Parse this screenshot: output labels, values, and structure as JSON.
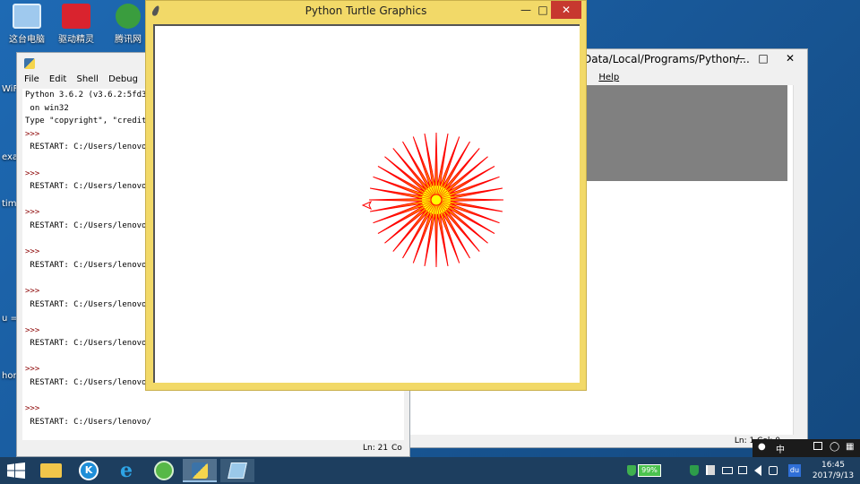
{
  "desktop": {
    "icons": [
      {
        "label": "这台电脑",
        "icon": "computer-icon",
        "color": "#9fc9ee"
      },
      {
        "label": "驱动精灵",
        "icon": "driver-genius-icon",
        "color": "#d9232e"
      },
      {
        "label": "腾讯网",
        "icon": "tencent-icon",
        "color": "#3a9d3e"
      }
    ],
    "peek_labels": [
      "WiF",
      "exa",
      "tim",
      "u =",
      "hor"
    ]
  },
  "shell_window": {
    "menu": [
      "File",
      "Edit",
      "Shell",
      "Debug",
      "Op"
    ],
    "console_lines": [
      {
        "kind": "out",
        "text": "Python 3.6.2 (v3.6.2:5fd3"
      },
      {
        "kind": "out",
        "text": " on win32"
      },
      {
        "kind": "out",
        "text": "Type \"copyright\", \"credit"
      },
      {
        "kind": "prompt",
        "text": ">>>"
      },
      {
        "kind": "out",
        "text": " RESTART: C:/Users/lenovo/"
      },
      {
        "kind": "out",
        "text": ""
      },
      {
        "kind": "prompt",
        "text": ">>>"
      },
      {
        "kind": "out",
        "text": " RESTART: C:/Users/lenovo/"
      },
      {
        "kind": "out",
        "text": ""
      },
      {
        "kind": "prompt",
        "text": ">>>"
      },
      {
        "kind": "out",
        "text": " RESTART: C:/Users/lenovo/"
      },
      {
        "kind": "out",
        "text": ""
      },
      {
        "kind": "prompt",
        "text": ">>>"
      },
      {
        "kind": "out",
        "text": " RESTART: C:/Users/lenovo/"
      },
      {
        "kind": "out",
        "text": ""
      },
      {
        "kind": "prompt",
        "text": ">>>"
      },
      {
        "kind": "out",
        "text": " RESTART: C:/Users/lenovo/"
      },
      {
        "kind": "out",
        "text": ""
      },
      {
        "kind": "prompt",
        "text": ">>>"
      },
      {
        "kind": "out",
        "text": " RESTART: C:/Users/lenovo/"
      },
      {
        "kind": "out",
        "text": ""
      },
      {
        "kind": "prompt",
        "text": ">>>"
      },
      {
        "kind": "out",
        "text": " RESTART: C:/Users/lenovo/"
      },
      {
        "kind": "out",
        "text": ""
      },
      {
        "kind": "prompt",
        "text": ">>>"
      },
      {
        "kind": "out",
        "text": " RESTART: C:/Users/lenovo/"
      },
      {
        "kind": "out",
        "text": ""
      },
      {
        "kind": "out",
        "text": ""
      },
      {
        "kind": "out",
        "text": " RESTART: C:/Users/lenovo/"
      }
    ],
    "status": {
      "line": "Ln: 21",
      "col": "Co"
    }
  },
  "editor_window": {
    "title": "Data/Local/Programs/Python/...",
    "menu": [
      "w",
      "Help"
    ],
    "status": "Ln: 1  Col: 0"
  },
  "turtle_window": {
    "title": "Python Turtle Graphics",
    "drawing": {
      "rays": 36,
      "stroke_color": "#ff0000",
      "fill_color": "#ffff00"
    }
  },
  "taskbar": {
    "apps": [
      {
        "icon": "file-explorer-icon",
        "color": "#f1c64a"
      },
      {
        "icon": "kugou-icon",
        "color": "#1e8ed8"
      },
      {
        "icon": "internet-explorer-icon",
        "color": "#2ea4e6"
      },
      {
        "icon": "browser-icon",
        "color": "#57b847"
      },
      {
        "icon": "python-idle-icon",
        "color": "#f5d54d"
      },
      {
        "icon": "notepad-icon",
        "color": "#9ac8e9"
      }
    ],
    "battery": "99%",
    "ime": "中",
    "clock_time": "16:45",
    "clock_date": "2017/9/13"
  }
}
